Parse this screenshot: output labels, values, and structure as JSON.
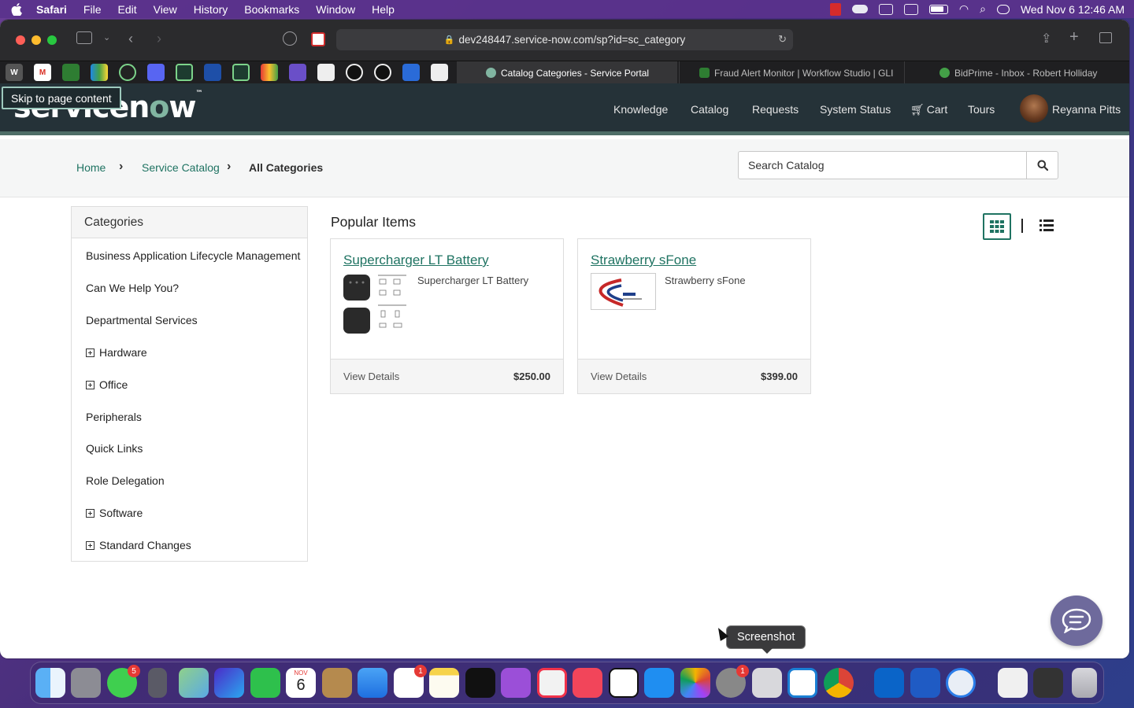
{
  "menubar": {
    "app": "Safari",
    "items": [
      "File",
      "Edit",
      "View",
      "History",
      "Bookmarks",
      "Window",
      "Help"
    ],
    "clock": "Wed Nov 6  12:46 AM"
  },
  "browser": {
    "url": "dev248447.service-now.com/sp?id=sc_category",
    "tabs": [
      {
        "title": "Catalog Categories - Service Portal",
        "active": true
      },
      {
        "title": "Fraud Alert Monitor | Workflow Studio | GLI",
        "active": false
      },
      {
        "title": "BidPrime - Inbox - Robert Holliday",
        "active": false
      }
    ],
    "favicons": [
      "W",
      "M",
      "",
      "",
      "",
      "",
      "",
      "",
      "",
      "",
      "",
      "",
      "",
      "",
      "",
      ""
    ]
  },
  "portal": {
    "skip_link": "Skip to page content",
    "logo_text_a": "servicen",
    "logo_text_o": "o",
    "logo_text_b": "w",
    "nav": [
      "Knowledge",
      "Catalog",
      "Requests",
      "System Status",
      "Cart",
      "Tours"
    ],
    "user_name": "Reyanna Pitts",
    "breadcrumb": [
      "Home",
      "Service Catalog",
      "All Categories"
    ],
    "search_placeholder": "Search Catalog",
    "categories_title": "Categories",
    "categories": [
      {
        "label": "Business Application Lifecycle Management",
        "expandable": false
      },
      {
        "label": "Can We Help You?",
        "expandable": false
      },
      {
        "label": "Departmental Services",
        "expandable": false
      },
      {
        "label": "Hardware",
        "expandable": true
      },
      {
        "label": "Office",
        "expandable": true
      },
      {
        "label": "Peripherals",
        "expandable": false
      },
      {
        "label": "Quick Links",
        "expandable": false
      },
      {
        "label": "Role Delegation",
        "expandable": false
      },
      {
        "label": "Software",
        "expandable": true
      },
      {
        "label": "Standard Changes",
        "expandable": true
      }
    ],
    "popular_title": "Popular Items",
    "items": [
      {
        "title": "Supercharger LT Battery",
        "description": "Supercharger LT Battery",
        "link": "View Details",
        "price": "$250.00"
      },
      {
        "title": "Strawberry sFone",
        "description": "Strawberry sFone",
        "link": "View Details",
        "price": "$399.00"
      }
    ]
  },
  "dock": {
    "tooltip": "Screenshot",
    "calendar_month": "NOV",
    "calendar_day": "6",
    "messages_badge": "5",
    "reminders_badge": "1",
    "settings_badge": "1"
  }
}
